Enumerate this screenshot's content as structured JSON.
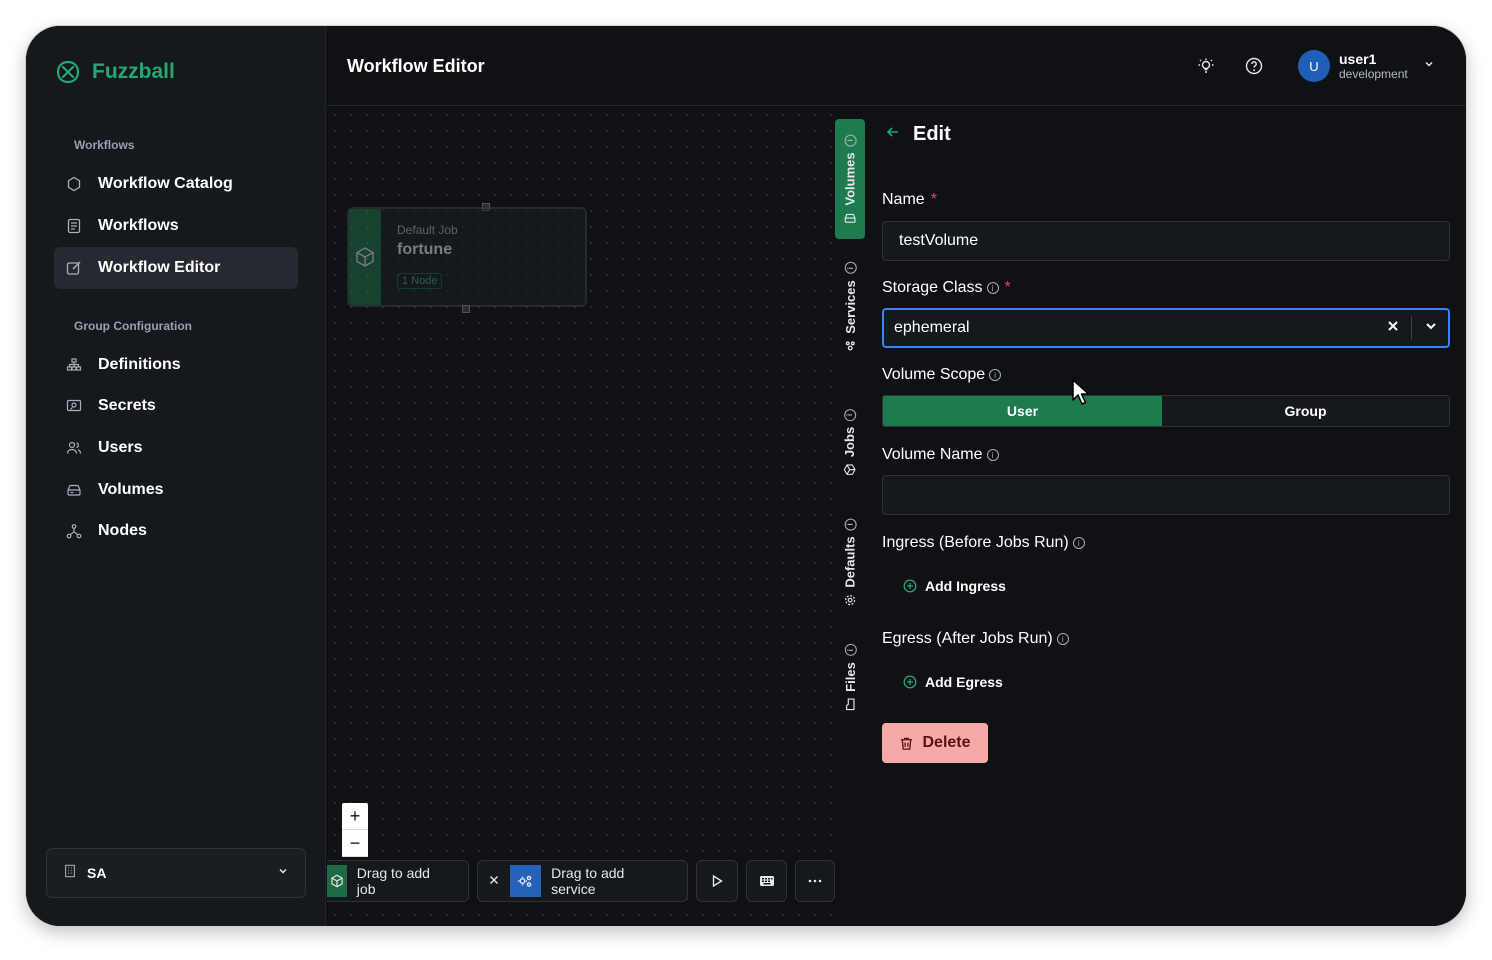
{
  "app": {
    "brand": "Fuzzball",
    "page_title": "Workflow Editor"
  },
  "sidebar": {
    "sections": [
      {
        "title": "Workflows",
        "items": [
          {
            "label": "Workflow Catalog",
            "icon": "hexagon-icon"
          },
          {
            "label": "Workflows",
            "icon": "list-icon"
          },
          {
            "label": "Workflow Editor",
            "icon": "edit-icon",
            "active": true
          }
        ]
      },
      {
        "title": "Group Configuration",
        "items": [
          {
            "label": "Definitions",
            "icon": "hierarchy-icon"
          },
          {
            "label": "Secrets",
            "icon": "secret-icon"
          },
          {
            "label": "Users",
            "icon": "users-icon"
          },
          {
            "label": "Volumes",
            "icon": "drive-icon"
          },
          {
            "label": "Nodes",
            "icon": "nodes-icon"
          }
        ]
      }
    ],
    "org": {
      "label": "SA"
    }
  },
  "topbar": {
    "user": {
      "initial": "U",
      "name": "user1",
      "env": "development"
    }
  },
  "canvas": {
    "job_node": {
      "type_label": "Default Job",
      "name": "fortune",
      "badge": "1 Node"
    },
    "toolbar": {
      "add_job": "Drag to add job",
      "add_service": "Drag to add service"
    }
  },
  "vtabs": [
    {
      "label": "Volumes",
      "active": true
    },
    {
      "label": "Services"
    },
    {
      "label": "Jobs"
    },
    {
      "label": "Defaults"
    },
    {
      "label": "Files"
    }
  ],
  "panel": {
    "title": "Edit",
    "name_label": "Name",
    "name_value": "testVolume",
    "storage_label": "Storage Class",
    "storage_value": "ephemeral",
    "scope_label": "Volume Scope",
    "scope_options": [
      "User",
      "Group"
    ],
    "scope_selected": "User",
    "volname_label": "Volume Name",
    "volname_value": "",
    "ingress_label": "Ingress (Before Jobs Run)",
    "add_ingress": "Add Ingress",
    "egress_label": "Egress (After Jobs Run)",
    "add_egress": "Add Egress",
    "delete": "Delete"
  },
  "colors": {
    "accent": "#1e7a4f",
    "brand": "#23a870",
    "focus": "#3b82f6",
    "danger_bg": "#f7a9a8"
  }
}
